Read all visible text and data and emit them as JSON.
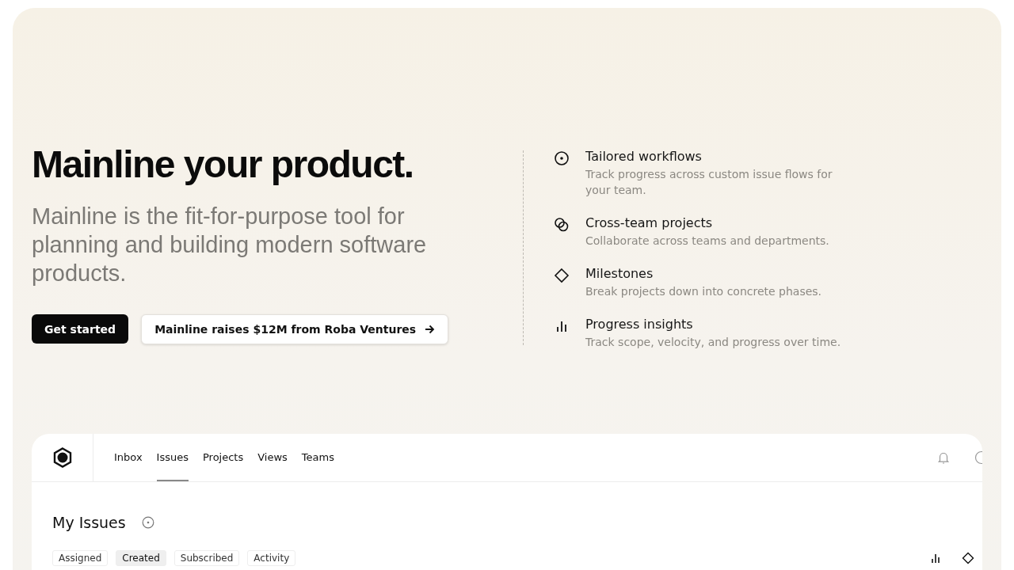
{
  "hero": {
    "title": "Mainline your product.",
    "subtitle": "Mainline is the fit-for-purpose tool for planning and building modern software products.",
    "primary_button": "Get started",
    "announcement_button": "Mainline raises $12M from Roba Ventures"
  },
  "features": [
    {
      "kind": "target",
      "title": "Tailored workflows",
      "text": "Track progress across custom issue flows for your team."
    },
    {
      "kind": "circles",
      "title": "Cross-team projects",
      "text": "Collaborate across teams and departments."
    },
    {
      "kind": "diamond",
      "title": "Milestones",
      "text": "Break projects down into concrete phases."
    },
    {
      "kind": "bars",
      "title": "Progress insights",
      "text": "Track scope, velocity, and progress over time."
    }
  ],
  "app": {
    "nav": [
      {
        "label": "Inbox",
        "selected": false
      },
      {
        "label": "Issues",
        "selected": true
      },
      {
        "label": "Projects",
        "selected": false
      },
      {
        "label": "Views",
        "selected": false
      },
      {
        "label": "Teams",
        "selected": false
      }
    ],
    "heading": "My Issues",
    "filters": [
      {
        "label": "Assigned",
        "selected": false
      },
      {
        "label": "Created",
        "selected": true
      },
      {
        "label": "Subscribed",
        "selected": false
      },
      {
        "label": "Activity",
        "selected": false
      }
    ]
  }
}
